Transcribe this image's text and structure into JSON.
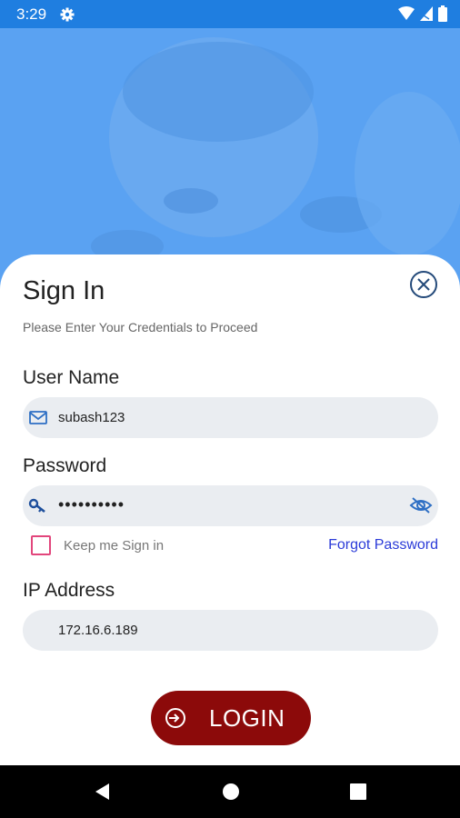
{
  "status": {
    "time": "3:29"
  },
  "signin": {
    "title": "Sign In",
    "subtitle": "Please Enter Your Credentials to Proceed",
    "username": {
      "label": "User Name",
      "value": "subash123"
    },
    "password": {
      "label": "Password",
      "value": "••••••••••"
    },
    "keep_label": "Keep me Sign in",
    "forgot_label": "Forgot Password",
    "ip": {
      "label": "IP Address",
      "value": "172.16.6.189"
    },
    "login_label": "LOGIN"
  },
  "colors": {
    "status_bar": "#1f7ee0",
    "hero": "#5aa2f2",
    "login_button": "#8c0a0a",
    "link": "#2b3bd8",
    "checkbox_border": "#e2467c",
    "field_bg": "#eaedf1"
  },
  "icons": {
    "status": [
      "gear-icon",
      "wifi-icon",
      "signal-icon",
      "battery-icon"
    ],
    "fields": [
      "mail-icon",
      "key-icon",
      "eye-off-icon"
    ],
    "close": "close-circle-icon",
    "login": "login-arrow-icon",
    "nav": [
      "back-icon",
      "home-icon",
      "recents-icon"
    ]
  }
}
